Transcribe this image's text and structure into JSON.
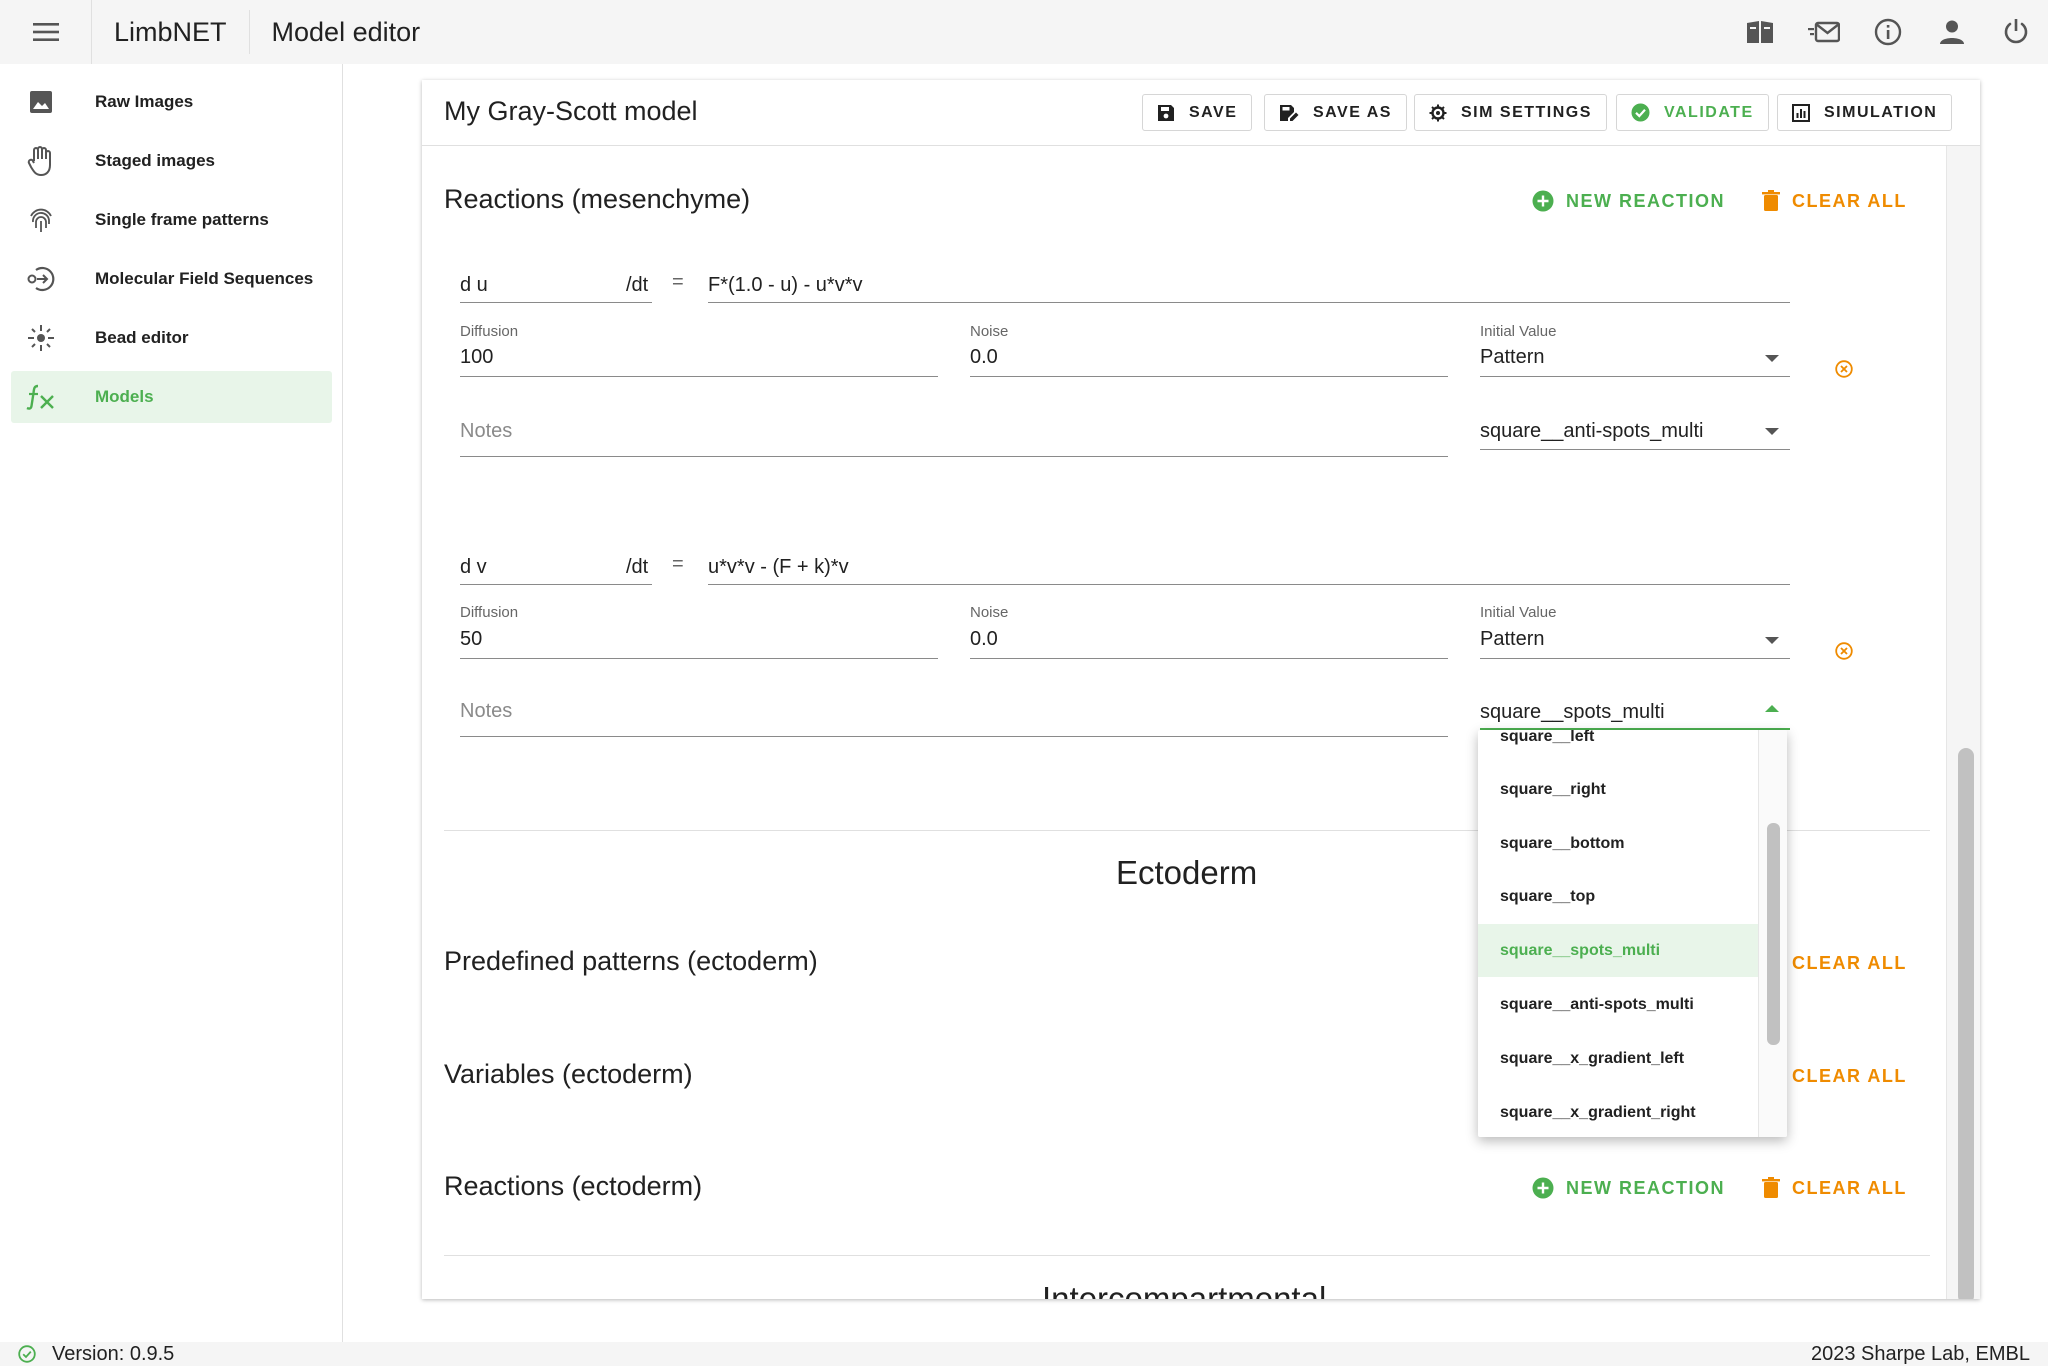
{
  "app": {
    "name": "LimbNET",
    "page_title": "Model editor"
  },
  "topbar_icons": [
    "book-icon",
    "mail-icon",
    "info-icon",
    "account-icon",
    "power-icon"
  ],
  "sidebar": {
    "items": [
      {
        "label": "Raw Images",
        "icon": "image-icon"
      },
      {
        "label": "Staged images",
        "icon": "hand-icon"
      },
      {
        "label": "Single frame patterns",
        "icon": "fingerprint-icon"
      },
      {
        "label": "Molecular Field Sequences",
        "icon": "sequence-icon"
      },
      {
        "label": "Bead editor",
        "icon": "bead-icon"
      },
      {
        "label": "Models",
        "icon": "function-icon",
        "active": true
      }
    ]
  },
  "editor": {
    "model_name": "My Gray-Scott model",
    "toolbar": {
      "save": "SAVE",
      "save_as": "SAVE AS",
      "sim_settings": "SIM SETTINGS",
      "validate": "VALIDATE",
      "simulation": "SIMULATION"
    },
    "mesenchyme": {
      "title": "Reactions (mesenchyme)",
      "new_reaction": "NEW REACTION",
      "clear_all": "CLEAR ALL",
      "reactions": [
        {
          "var": "d u",
          "per_dt": "/dt",
          "equals": "=",
          "expression": "F*(1.0 - u) - u*v*v",
          "diffusion_label": "Diffusion",
          "diffusion": "100",
          "noise_label": "Noise",
          "noise": "0.0",
          "initial_label": "Initial Value",
          "initial": "Pattern",
          "notes_placeholder": "Notes",
          "pattern": "square__anti-spots_multi"
        },
        {
          "var": "d v",
          "per_dt": "/dt",
          "equals": "=",
          "expression": "u*v*v - (F + k)*v",
          "diffusion_label": "Diffusion",
          "diffusion": "50",
          "noise_label": "Noise",
          "noise": "0.0",
          "initial_label": "Initial Value",
          "initial": "Pattern",
          "notes_placeholder": "Notes",
          "pattern": "square__spots_multi"
        }
      ]
    },
    "ectoderm": {
      "heading": "Ectoderm",
      "predefined_title": "Predefined patterns (ectoderm)",
      "variables_title": "Variables (ectoderm)",
      "reactions_title": "Reactions (ectoderm)",
      "new_reaction": "NEW REACTION",
      "clear_all": "CLEAR ALL"
    },
    "intercompartmental_heading": "Intercompartmental"
  },
  "dropdown": {
    "options": [
      "square__left",
      "square__right",
      "square__bottom",
      "square__top",
      "square__spots_multi",
      "square__anti-spots_multi",
      "square__x_gradient_left",
      "square__x_gradient_right"
    ],
    "selected": "square__spots_multi"
  },
  "footer": {
    "version": "Version: 0.9.5",
    "copyright": "2023 Sharpe Lab, EMBL"
  },
  "colors": {
    "accent": "#4caf50",
    "warning": "#ef8b00",
    "remove": "#ef8b00"
  }
}
